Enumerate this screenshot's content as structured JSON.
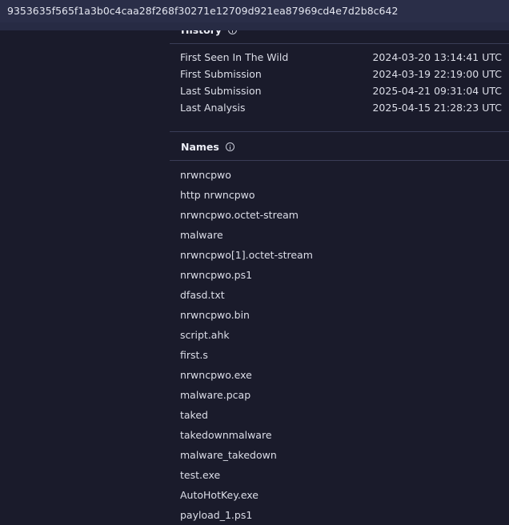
{
  "file": {
    "hash": "9353635f565f1a3b0c4caa28f268f30271e12709d921ea87969cd4e7d2b8c642"
  },
  "history": {
    "title": "History",
    "rows": [
      {
        "label": "First Seen In The Wild",
        "value": "2024-03-20 13:14:41 UTC"
      },
      {
        "label": "First Submission",
        "value": "2024-03-19 22:19:00 UTC"
      },
      {
        "label": "Last Submission",
        "value": "2025-04-21 09:31:04 UTC"
      },
      {
        "label": "Last Analysis",
        "value": "2025-04-15 21:28:23 UTC"
      }
    ]
  },
  "names": {
    "title": "Names",
    "items": [
      "nrwncpwo",
      "http nrwncpwo",
      "nrwncpwo.octet-stream",
      "malware",
      "nrwncpwo[1].octet-stream",
      "nrwncpwo.ps1",
      "dfasd.txt",
      "nrwncpwo.bin",
      "script.ahk",
      "first.s",
      "nrwncpwo.exe",
      "malware.pcap",
      "taked",
      "takedownmalware",
      "malware_takedown",
      "test.exe",
      "AutoHotKey.exe",
      "payload_1.ps1"
    ]
  },
  "icons": {
    "history_info": "info-circle-icon",
    "names_info": "info-circle-icon"
  },
  "colors": {
    "background": "#1a1b2b",
    "topbar": "#2a2e48",
    "divider": "#3a3d57",
    "text": "#dcdee8"
  }
}
